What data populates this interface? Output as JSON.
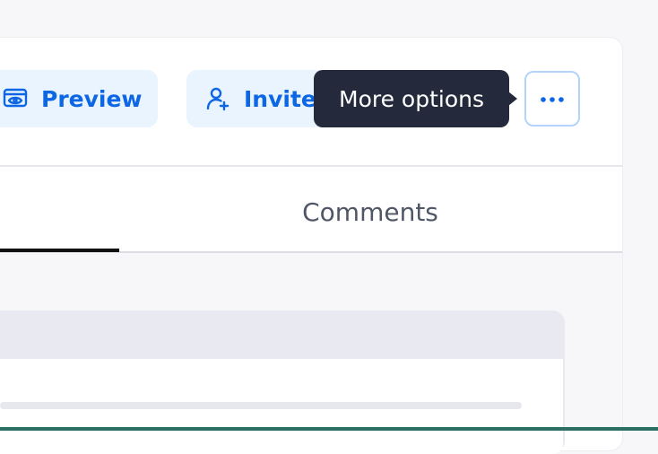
{
  "toolbar": {
    "preview_label": "Preview",
    "preview_icon": "eye-screen-icon",
    "invite_label": "Invite",
    "invite_icon": "user-plus-icon",
    "more_icon": "more-horizontal-icon",
    "accent_color": "#0d66e4"
  },
  "tooltip": {
    "text": "More options"
  },
  "tabs": {
    "comments_label": "Comments"
  }
}
